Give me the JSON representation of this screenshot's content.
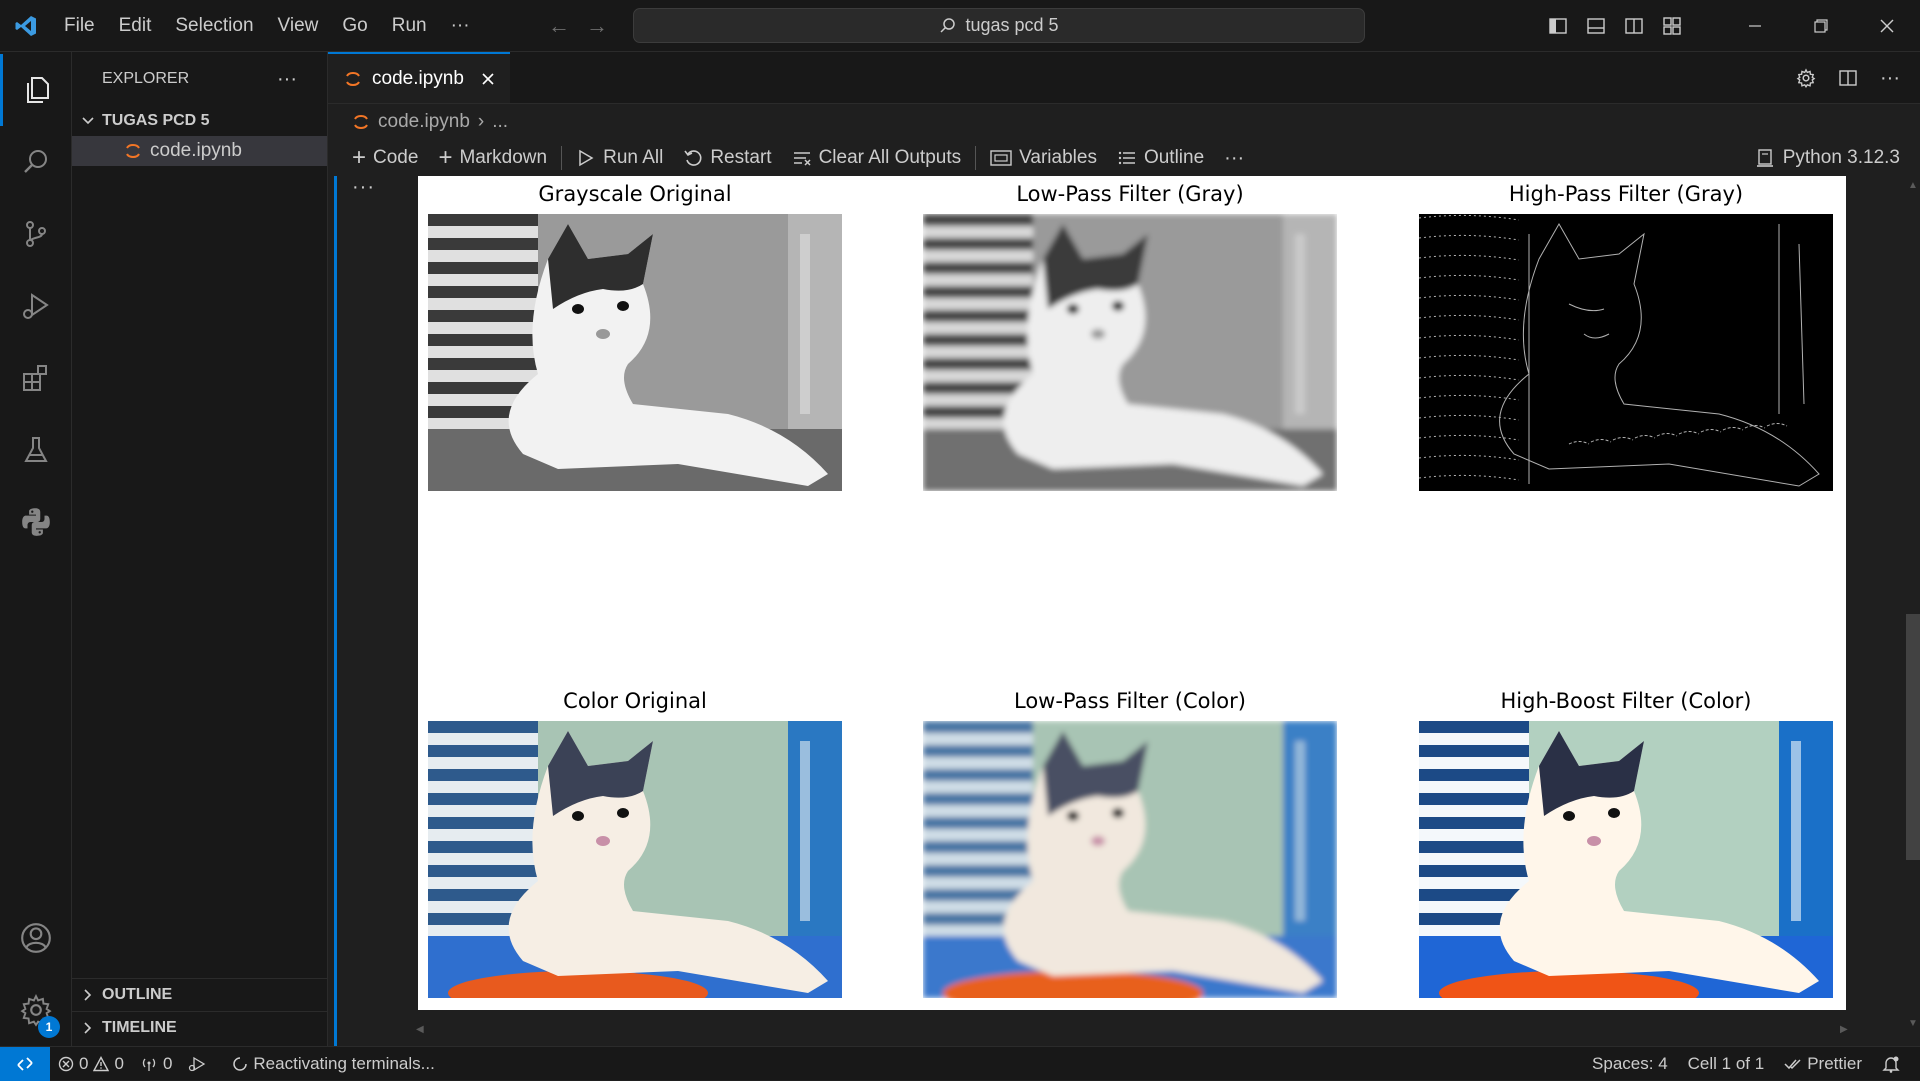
{
  "titlebar": {
    "menus": [
      "File",
      "Edit",
      "Selection",
      "View",
      "Go",
      "Run",
      "···"
    ],
    "search_text": "tugas pcd 5"
  },
  "sidebar": {
    "title": "EXPLORER",
    "more": "···",
    "folder": "TUGAS PCD 5",
    "file": "code.ipynb",
    "outline": "OUTLINE",
    "timeline": "TIMELINE"
  },
  "editor": {
    "tab_label": "code.ipynb",
    "breadcrumb_file": "code.ipynb",
    "breadcrumb_rest": "...",
    "toolbar": {
      "code": "Code",
      "markdown": "Markdown",
      "run_all": "Run All",
      "restart": "Restart",
      "clear_outputs": "Clear All Outputs",
      "variables": "Variables",
      "outline": "Outline",
      "more": "···"
    },
    "kernel": "Python 3.12.3",
    "cell_menu": "···"
  },
  "output": {
    "plots": [
      {
        "title": "Grayscale Original",
        "mode": "gray"
      },
      {
        "title": "Low-Pass Filter (Gray)",
        "mode": "gray-blur"
      },
      {
        "title": "High-Pass Filter (Gray)",
        "mode": "edges"
      },
      {
        "title": "Color Original",
        "mode": "color"
      },
      {
        "title": "Low-Pass Filter (Color)",
        "mode": "color-blur"
      },
      {
        "title": "High-Boost Filter (Color)",
        "mode": "color-boost"
      }
    ]
  },
  "statusbar": {
    "errors": "0",
    "warnings": "0",
    "ports": "0",
    "activity": "Reactivating terminals...",
    "spaces": "Spaces: 4",
    "cell": "Cell 1 of 1",
    "formatter": "Prettier"
  },
  "activity_badge": "1",
  "colors": {
    "accent": "#0078d4",
    "jupyter_orange": "#f37626"
  }
}
